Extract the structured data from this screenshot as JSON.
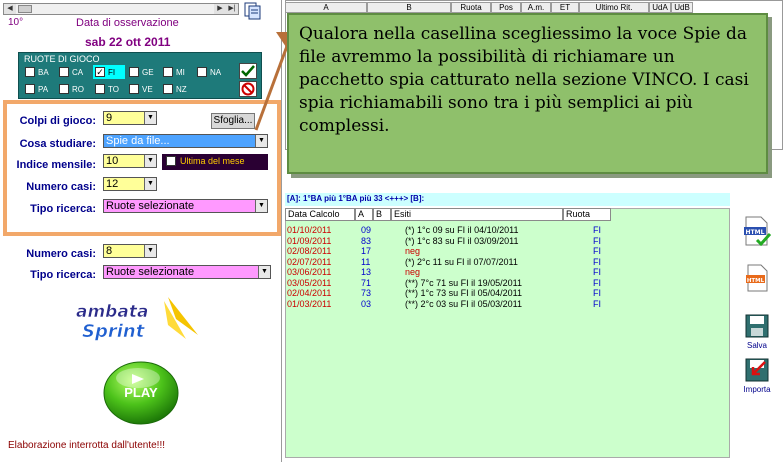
{
  "header": {
    "number": "10°",
    "observation_label": "Data di osservazione",
    "observation_date": "sab 22 ott 2011"
  },
  "ruote": {
    "title": "RUOTE DI GIOCO",
    "row1": [
      {
        "code": "BA",
        "checked": false
      },
      {
        "code": "CA",
        "checked": false
      },
      {
        "code": "FI",
        "checked": true
      },
      {
        "code": "GE",
        "checked": false
      },
      {
        "code": "MI",
        "checked": false
      },
      {
        "code": "NA",
        "checked": false
      }
    ],
    "row2": [
      {
        "code": "PA",
        "checked": false
      },
      {
        "code": "RO",
        "checked": false
      },
      {
        "code": "TO",
        "checked": false
      },
      {
        "code": "VE",
        "checked": false
      },
      {
        "code": "NZ",
        "checked": false
      }
    ]
  },
  "form": {
    "colpi_label": "Colpi di gioco:",
    "colpi_value": "9",
    "sfoglia_label": "Sfoglia...",
    "cosa_label": "Cosa studiare:",
    "cosa_value": "Spie da file...",
    "indice_label": "Indice mensile:",
    "indice_value": "10",
    "ultima_label": "Ultima del mese",
    "numero_label": "Numero casi:",
    "numero_value": "12",
    "tipo_label": "Tipo ricerca:",
    "tipo_value": "Ruote selezionate"
  },
  "form2": {
    "numero_label": "Numero casi:",
    "numero_value": "8",
    "tipo_label": "Tipo ricerca:",
    "tipo_value": "Ruote selezionate"
  },
  "logo": {
    "line1": "ambata",
    "line2": "Sprint"
  },
  "play_label": "PLAY",
  "status": "Elaborazione interrotta dall'utente!!!",
  "sheet_columns": [
    "A",
    "B",
    "Ruota",
    "Pos",
    "A.m.",
    "ET",
    "Ultimo Rit.",
    "UdA",
    "UdB"
  ],
  "callout": "Qualora nella casellina scegliessimo la voce Spie da file avremmo la possibilità di richiamare un pacchetto spia catturato nella sezione VINCO. I casi spia richiamabili sono tra i più semplici ai più complessi.",
  "summary": "[A]: 1°BA più  1°BA  più 33 <+++> [B]:",
  "results": {
    "headers": [
      "Data Calcolo",
      "A",
      "B",
      "Esiti",
      "Ruota"
    ],
    "rows": [
      {
        "date": "01/10/2011",
        "a": "09",
        "b": "",
        "esito": "(*) 1°c 09 su FI il 04/10/2011",
        "ruota": "FI"
      },
      {
        "date": "01/09/2011",
        "a": "83",
        "b": "",
        "esito": "(*) 1°c 83 su FI il 03/09/2011",
        "ruota": "FI"
      },
      {
        "date": "02/08/2011",
        "a": "17",
        "b": "",
        "esito": "neg",
        "ruota": "FI"
      },
      {
        "date": "02/07/2011",
        "a": "11",
        "b": "",
        "esito": "(*) 2°c 11 su FI il 07/07/2011",
        "ruota": "FI"
      },
      {
        "date": "03/06/2011",
        "a": "13",
        "b": "",
        "esito": "neg",
        "ruota": "FI"
      },
      {
        "date": "03/05/2011",
        "a": "71",
        "b": "",
        "esito": "(**) 7°c 71 su FI il 19/05/2011",
        "ruota": "FI"
      },
      {
        "date": "02/04/2011",
        "a": "73",
        "b": "",
        "esito": "(**) 1°c 73 su FI il 05/04/2011",
        "ruota": "FI"
      },
      {
        "date": "01/03/2011",
        "a": "03",
        "b": "",
        "esito": "(**) 2°c 03 su FI il 05/03/2011",
        "ruota": "FI"
      }
    ]
  },
  "side_icons": {
    "html_label": "HTML",
    "html2_label": "HTML",
    "salva_label": "Salva",
    "importa_label": "Importa"
  },
  "colors": {
    "callout_bg": "#8fc06b",
    "grid_bg": "#ccffcc",
    "ruote_bg": "#1e7a7a",
    "date_red": "#cc0000",
    "number_blue": "#0000cc"
  }
}
